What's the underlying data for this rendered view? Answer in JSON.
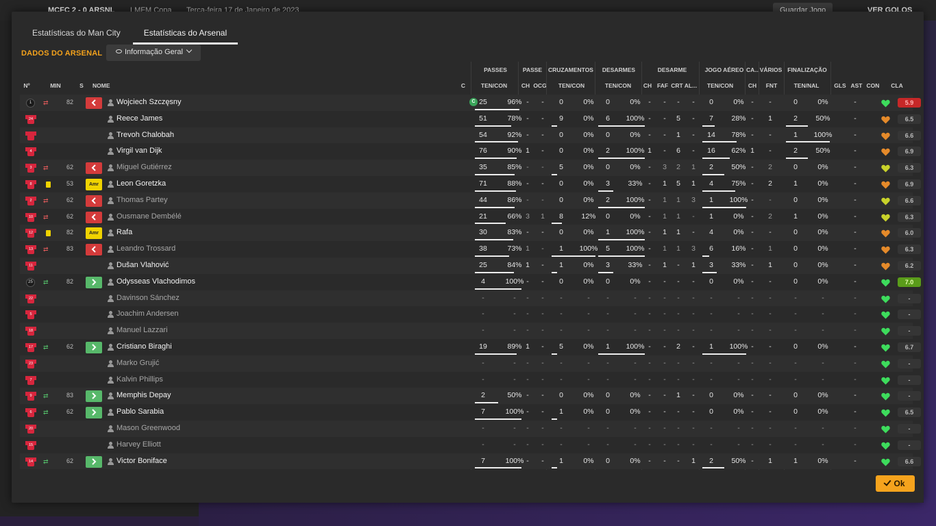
{
  "topbar": {
    "score": "MCFC 2 - 0 ARSNL",
    "competition": "LMFM Copa",
    "date": "Terça-feira 17 de Janeiro de 2023",
    "save_label": "Guardar Jogo",
    "goals_label": "VER GOLOS"
  },
  "tabs": [
    {
      "label": "Estatísticas do Man City"
    },
    {
      "label": "Estatísticas do Arsenal"
    }
  ],
  "section_title": "DADOS DO ARSENAL",
  "view_dropdown": "Informação Geral",
  "group_headers": {
    "passes": "PASSES",
    "passe": "PASSE",
    "cruz": "CRUZAMENTOS",
    "desarmes": "DESARMES",
    "desarme": "DESARME",
    "jogo_aereo": "JOGO AÉREO",
    "ca": "CA...",
    "varios": "VÁRIOS",
    "finalizacao": "FINALIZAÇÃO"
  },
  "col_headers": {
    "no": "Nº",
    "min": "MIN",
    "s": "S",
    "nome": "NOME",
    "c": "C",
    "passes": "TEN/CON",
    "p_ch": "CH",
    "p_ocg": "OCG",
    "cruz": "TEN/CON",
    "des": "TEN/CON",
    "d_ch": "CH",
    "d_faf": "FAF",
    "d_crt": "CRT",
    "d_al": "AL...",
    "aer": "TEN/CON",
    "ca_ch": "CH",
    "fnt": "FNT",
    "fin": "TEN/NAL",
    "gls": "GLS",
    "ast": "AST",
    "con": "CON",
    "cla": "CLA"
  },
  "players": [
    {
      "no": "1",
      "gk": true,
      "sub": "both",
      "min": "82",
      "status": "off",
      "name": "Wojciech Szczęsny",
      "captain": "C",
      "played": true,
      "pass": [
        "25",
        "96%"
      ],
      "pch": "-",
      "pocg": "-",
      "cruz": [
        "0",
        "0%"
      ],
      "des": [
        "0",
        "0%"
      ],
      "dch": "-",
      "faf": "-",
      "crt": "-",
      "al": "-",
      "aer": [
        "0",
        "0%"
      ],
      "cach": "-",
      "fnt": "-",
      "fin": [
        "0",
        "0%"
      ],
      "gls": "",
      "ast": "-",
      "heart": "green",
      "cla": "5.9",
      "cla_style": "red",
      "pbar": 0.96,
      "cbar": 0,
      "dbar": 0,
      "abar": 0,
      "fbar": 0
    },
    {
      "no": "24",
      "name": "Reece James",
      "played": true,
      "pass": [
        "51",
        "78%"
      ],
      "pch": "-",
      "pocg": "-",
      "cruz": [
        "9",
        "0%"
      ],
      "des": [
        "6",
        "100%"
      ],
      "dch": "-",
      "faf": "-",
      "crt": "5",
      "al": "-",
      "aer": [
        "7",
        "28%"
      ],
      "cach": "-",
      "fnt": "1",
      "fin": [
        "2",
        "50%"
      ],
      "gls": "",
      "ast": "-",
      "heart": "orange",
      "cla": "6.5",
      "pbar": 0.78,
      "cbar": 0,
      "dbar": 1,
      "abar": 0.28,
      "fbar": 0.5
    },
    {
      "no": "",
      "name": "Trevoh Chalobah",
      "played": true,
      "pass": [
        "54",
        "92%"
      ],
      "pch": "-",
      "pocg": "-",
      "cruz": [
        "0",
        "0%"
      ],
      "des": [
        "0",
        "0%"
      ],
      "dch": "-",
      "faf": "-",
      "crt": "1",
      "al": "-",
      "aer": [
        "14",
        "78%"
      ],
      "cach": "-",
      "fnt": "-",
      "fin": [
        "1",
        "100%"
      ],
      "gls": "",
      "ast": "-",
      "heart": "orange",
      "cla": "6.6",
      "pbar": 0.92,
      "cbar": 0,
      "dbar": 0,
      "abar": 0.78,
      "fbar": 1
    },
    {
      "no": "4",
      "name": "Virgil van Dijk",
      "played": true,
      "pass": [
        "76",
        "90%"
      ],
      "pch": "1",
      "pocg": "-",
      "cruz": [
        "0",
        "0%"
      ],
      "des": [
        "2",
        "100%"
      ],
      "dch": "1",
      "faf": "-",
      "crt": "6",
      "al": "-",
      "aer": [
        "16",
        "62%"
      ],
      "cach": "1",
      "fnt": "-",
      "fin": [
        "2",
        "50%"
      ],
      "gls": "",
      "ast": "-",
      "heart": "orange",
      "cla": "6.9",
      "pbar": 0.9,
      "cbar": 0,
      "dbar": 1,
      "abar": 0.62,
      "fbar": 0.5
    },
    {
      "no": "3",
      "sub": "both",
      "min": "62",
      "status": "off",
      "name": "Miguel Gutiérrez",
      "dim": true,
      "played": true,
      "pass": [
        "35",
        "85%"
      ],
      "pch": "-",
      "pocg": "-",
      "cruz": [
        "5",
        "0%"
      ],
      "des": [
        "0",
        "0%"
      ],
      "dch": "-",
      "faf": "3",
      "crt": "2",
      "al": "1",
      "aer": [
        "2",
        "50%"
      ],
      "cach": "-",
      "fnt": "2",
      "fin": [
        "0",
        "0%"
      ],
      "gls": "",
      "ast": "-",
      "heart": "yellow",
      "cla": "6.3",
      "pbar": 0.85,
      "cbar": 0,
      "dbar": 0,
      "abar": 0.5,
      "fbar": 0
    },
    {
      "no": "8",
      "card": true,
      "min": "53",
      "status": "amr",
      "name": "Leon Goretzka",
      "played": true,
      "pass": [
        "71",
        "88%"
      ],
      "pch": "-",
      "pocg": "-",
      "cruz": [
        "0",
        "0%"
      ],
      "des": [
        "3",
        "33%"
      ],
      "dch": "-",
      "faf": "1",
      "crt": "5",
      "al": "1",
      "aer": [
        "4",
        "75%"
      ],
      "cach": "-",
      "fnt": "2",
      "fin": [
        "1",
        "0%"
      ],
      "gls": "",
      "ast": "-",
      "heart": "orange",
      "cla": "6.9",
      "pbar": 0.88,
      "cbar": 0,
      "dbar": 0.33,
      "abar": 0.75,
      "fbar": 0
    },
    {
      "no": "2",
      "sub": "both",
      "min": "62",
      "status": "off",
      "name": "Thomas Partey",
      "dim": true,
      "played": true,
      "pass": [
        "44",
        "86%"
      ],
      "pch": "-",
      "pocg": "-",
      "cruz": [
        "0",
        "0%"
      ],
      "des": [
        "2",
        "100%"
      ],
      "dch": "-",
      "faf": "1",
      "crt": "1",
      "al": "3",
      "aer": [
        "1",
        "100%"
      ],
      "cach": "-",
      "fnt": "-",
      "fin": [
        "0",
        "0%"
      ],
      "gls": "",
      "ast": "-",
      "heart": "yellow",
      "cla": "6.6",
      "pbar": 0.86,
      "cbar": 0,
      "dbar": 1,
      "abar": 1,
      "fbar": 0
    },
    {
      "no": "10",
      "sub": "both",
      "min": "62",
      "status": "off",
      "name": "Ousmane Dembélé",
      "dim": true,
      "played": true,
      "pass": [
        "21",
        "66%"
      ],
      "pch": "3",
      "pocg": "1",
      "cruz": [
        "8",
        "12%"
      ],
      "des": [
        "0",
        "0%"
      ],
      "dch": "-",
      "faf": "1",
      "crt": "1",
      "al": "-",
      "aer": [
        "1",
        "0%"
      ],
      "cach": "-",
      "fnt": "2",
      "fin": [
        "1",
        "0%"
      ],
      "gls": "",
      "ast": "-",
      "heart": "yellow",
      "cla": "6.3",
      "pbar": 0.66,
      "cbar": 0.12,
      "dbar": 0,
      "abar": 0,
      "fbar": 0
    },
    {
      "no": "12",
      "card": true,
      "min": "82",
      "status": "amr",
      "name": "Rafa",
      "played": true,
      "pass": [
        "30",
        "83%"
      ],
      "pch": "-",
      "pocg": "-",
      "cruz": [
        "0",
        "0%"
      ],
      "des": [
        "1",
        "100%"
      ],
      "dch": "-",
      "faf": "1",
      "crt": "1",
      "al": "-",
      "aer": [
        "4",
        "0%"
      ],
      "cach": "-",
      "fnt": "-",
      "fin": [
        "0",
        "0%"
      ],
      "gls": "",
      "ast": "-",
      "heart": "orange",
      "cla": "6.0",
      "pbar": 0.83,
      "cbar": 0,
      "dbar": 1,
      "abar": 0,
      "fbar": 0
    },
    {
      "no": "13",
      "sub": "both",
      "min": "83",
      "status": "off",
      "name": "Leandro Trossard",
      "dim": true,
      "played": true,
      "pass": [
        "38",
        "73%"
      ],
      "pch": "1",
      "pocg": "-",
      "cruz": [
        "1",
        "100%"
      ],
      "des": [
        "5",
        "100%"
      ],
      "dch": "-",
      "faf": "1",
      "crt": "1",
      "al": "3",
      "aer": [
        "6",
        "16%"
      ],
      "cach": "-",
      "fnt": "1",
      "fin": [
        "0",
        "0%"
      ],
      "gls": "",
      "ast": "-",
      "heart": "orange",
      "cla": "6.3",
      "pbar": 0.73,
      "cbar": 1,
      "dbar": 1,
      "abar": 0.16,
      "fbar": 0
    },
    {
      "no": "11",
      "name": "Dušan Vlahović",
      "played": true,
      "pass": [
        "25",
        "84%"
      ],
      "pch": "1",
      "pocg": "-",
      "cruz": [
        "1",
        "0%"
      ],
      "des": [
        "3",
        "33%"
      ],
      "dch": "-",
      "faf": "1",
      "crt": "-",
      "al": "1",
      "aer": [
        "3",
        "33%"
      ],
      "cach": "-",
      "fnt": "1",
      "fin": [
        "0",
        "0%"
      ],
      "gls": "",
      "ast": "-",
      "heart": "orange",
      "cla": "6.2",
      "pbar": 0.84,
      "cbar": 0,
      "dbar": 0.33,
      "abar": 0.33,
      "fbar": 0
    },
    {
      "no": "25",
      "gk": true,
      "sub": "in",
      "min": "82",
      "status": "on",
      "name": "Odysseas Vlachodimos",
      "played": true,
      "pass": [
        "4",
        "100%"
      ],
      "pch": "-",
      "pocg": "-",
      "cruz": [
        "0",
        "0%"
      ],
      "des": [
        "0",
        "0%"
      ],
      "dch": "-",
      "faf": "-",
      "crt": "-",
      "al": "-",
      "aer": [
        "0",
        "0%"
      ],
      "cach": "-",
      "fnt": "-",
      "fin": [
        "0",
        "0%"
      ],
      "gls": "",
      "ast": "-",
      "heart": "green",
      "cla": "7.0",
      "cla_style": "green",
      "pbar": 1,
      "cbar": 0,
      "dbar": 0,
      "abar": 0,
      "fbar": 0
    },
    {
      "no": "22",
      "name": "Davinson Sánchez",
      "dim": true,
      "played": false,
      "heart": "green",
      "cla": "-"
    },
    {
      "no": "5",
      "name": "Joachim Andersen",
      "dim": true,
      "played": false,
      "heart": "green",
      "cla": "-"
    },
    {
      "no": "18",
      "name": "Manuel Lazzari",
      "dim": true,
      "played": false,
      "heart": "green",
      "cla": "-"
    },
    {
      "no": "17",
      "sub": "in",
      "min": "62",
      "status": "on",
      "name": "Cristiano Biraghi",
      "played": true,
      "pass": [
        "19",
        "89%"
      ],
      "pch": "1",
      "pocg": "-",
      "cruz": [
        "5",
        "0%"
      ],
      "des": [
        "1",
        "100%"
      ],
      "dch": "-",
      "faf": "-",
      "crt": "2",
      "al": "-",
      "aer": [
        "1",
        "100%"
      ],
      "cach": "-",
      "fnt": "-",
      "fin": [
        "0",
        "0%"
      ],
      "gls": "",
      "ast": "-",
      "heart": "green",
      "cla": "6.7",
      "pbar": 0.89,
      "cbar": 0,
      "dbar": 1,
      "abar": 1,
      "fbar": 0
    },
    {
      "no": "23",
      "name": "Marko Grujić",
      "dim": true,
      "played": false,
      "heart": "green",
      "cla": "-"
    },
    {
      "no": "7",
      "name": "Kalvin Phillips",
      "dim": true,
      "played": false,
      "heart": "green",
      "cla": "-"
    },
    {
      "no": "9",
      "sub": "in",
      "min": "83",
      "status": "on",
      "name": "Memphis Depay",
      "played": true,
      "pass": [
        "2",
        "50%"
      ],
      "pch": "-",
      "pocg": "-",
      "cruz": [
        "0",
        "0%"
      ],
      "des": [
        "0",
        "0%"
      ],
      "dch": "-",
      "faf": "-",
      "crt": "1",
      "al": "-",
      "aer": [
        "0",
        "0%"
      ],
      "cach": "-",
      "fnt": "-",
      "fin": [
        "0",
        "0%"
      ],
      "gls": "",
      "ast": "-",
      "heart": "green",
      "cla": "-",
      "pbar": 0.5,
      "cbar": 0,
      "dbar": 0,
      "abar": 0,
      "fbar": 0
    },
    {
      "no": "6",
      "sub": "in",
      "min": "62",
      "status": "on",
      "name": "Pablo Sarabia",
      "played": true,
      "pass": [
        "7",
        "100%"
      ],
      "pch": "-",
      "pocg": "-",
      "cruz": [
        "1",
        "0%"
      ],
      "des": [
        "0",
        "0%"
      ],
      "dch": "-",
      "faf": "-",
      "crt": "-",
      "al": "-",
      "aer": [
        "0",
        "0%"
      ],
      "cach": "-",
      "fnt": "-",
      "fin": [
        "0",
        "0%"
      ],
      "gls": "",
      "ast": "-",
      "heart": "green",
      "cla": "6.5",
      "pbar": 1,
      "cbar": 0,
      "dbar": 0,
      "abar": 0,
      "fbar": 0
    },
    {
      "no": "20",
      "name": "Mason Greenwood",
      "dim": true,
      "played": false,
      "heart": "green",
      "cla": "-"
    },
    {
      "no": "15",
      "name": "Harvey Elliott",
      "dim": true,
      "played": false,
      "heart": "green",
      "cla": "-"
    },
    {
      "no": "14",
      "sub": "in",
      "min": "62",
      "status": "on",
      "name": "Victor Boniface",
      "played": true,
      "pass": [
        "7",
        "100%"
      ],
      "pch": "-",
      "pocg": "-",
      "cruz": [
        "1",
        "0%"
      ],
      "des": [
        "0",
        "0%"
      ],
      "dch": "-",
      "faf": "-",
      "crt": "-",
      "al": "1",
      "aer": [
        "2",
        "50%"
      ],
      "cach": "-",
      "fnt": "1",
      "fin": [
        "1",
        "0%"
      ],
      "gls": "",
      "ast": "-",
      "heart": "green",
      "cla": "6.6",
      "pbar": 1,
      "cbar": 0,
      "dbar": 0,
      "abar": 0.5,
      "fbar": 0
    }
  ],
  "status_labels": {
    "amr": "Amr"
  },
  "ok_label": "Ok",
  "colors": {
    "accent": "#f5a31d",
    "heart_green": "#3ddc5c",
    "heart_orange": "#e58a2a",
    "heart_yellow": "#c8d22a"
  }
}
